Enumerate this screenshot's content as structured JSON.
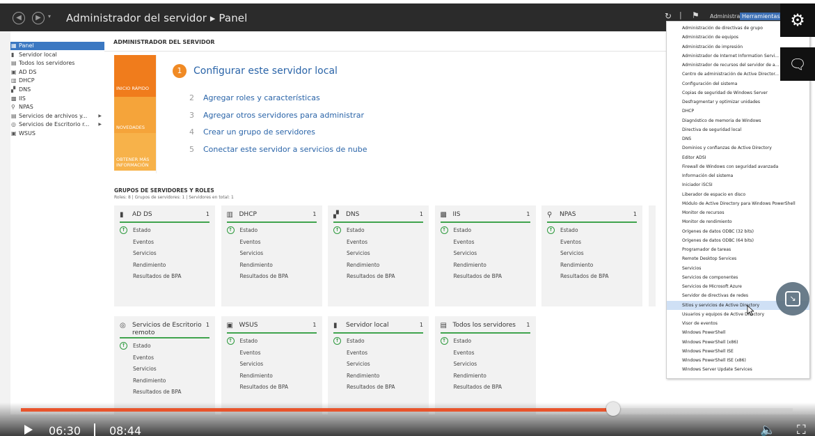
{
  "window": {
    "breadcrumb": "Administrador del servidor ▸ Panel",
    "refresh_glyph": "↻",
    "flag_glyph": "⚑",
    "menu_administrar": "Administrar",
    "menu_herramientas": "Herramientas"
  },
  "sidebar": {
    "items": [
      {
        "label": "Panel",
        "icon": "▦",
        "icon_name": "dashboard-icon"
      },
      {
        "label": "Servidor local",
        "icon": "▮",
        "icon_name": "server-icon"
      },
      {
        "label": "Todos los servidores",
        "icon": "▤",
        "icon_name": "servers-icon"
      },
      {
        "label": "AD DS",
        "icon": "▣",
        "icon_name": "adds-icon"
      },
      {
        "label": "DHCP",
        "icon": "▥",
        "icon_name": "dhcp-icon"
      },
      {
        "label": "DNS",
        "icon": "▞",
        "icon_name": "dns-icon"
      },
      {
        "label": "IIS",
        "icon": "▩",
        "icon_name": "iis-icon"
      },
      {
        "label": "NPAS",
        "icon": "⚲",
        "icon_name": "npas-icon"
      },
      {
        "label": "Servicios de archivos y...",
        "icon": "▤",
        "icon_name": "file-services-icon"
      },
      {
        "label": "Servicios de Escritorio r...",
        "icon": "◎",
        "icon_name": "remote-desktop-icon"
      },
      {
        "label": "WSUS",
        "icon": "▣",
        "icon_name": "wsus-icon"
      }
    ]
  },
  "main": {
    "header": "ADMINISTRADOR DEL SERVIDOR",
    "quickstart": {
      "inicio_rapido": "INICIO RÁPIDO",
      "novedades": "NOVEDADES",
      "obtener_mas": "OBTENER MÁS INFORMACIÓN",
      "main_step_number": "1",
      "main_step_label": "Configurar este servidor local",
      "steps": [
        {
          "num": "2",
          "label": "Agregar roles y características"
        },
        {
          "num": "3",
          "label": "Agregar otros servidores para administrar"
        },
        {
          "num": "4",
          "label": "Crear un grupo de servidores"
        },
        {
          "num": "5",
          "label": "Conectar este servidor a servicios de nube"
        }
      ]
    },
    "groups": {
      "title": "GRUPOS DE SERVIDORES Y ROLES",
      "subtitle": "Roles: 8   |   Grupos de servidores: 1   |   Servidores en total: 1",
      "cards_row1": [
        {
          "title": "AD DS",
          "count": "1",
          "icon": "▮",
          "icon_name": "adds-icon"
        },
        {
          "title": "DHCP",
          "count": "1",
          "icon": "▥",
          "icon_name": "dhcp-icon"
        },
        {
          "title": "DNS",
          "count": "1",
          "icon": "▞",
          "icon_name": "dns-icon"
        },
        {
          "title": "IIS",
          "count": "1",
          "icon": "▩",
          "icon_name": "iis-icon"
        },
        {
          "title": "NPAS",
          "count": "1",
          "icon": "⚲",
          "icon_name": "npas-icon"
        }
      ],
      "cards_row2": [
        {
          "title": "Servicios de Escritorio remoto",
          "count": "1",
          "icon": "◎",
          "icon_name": "remote-desktop-icon"
        },
        {
          "title": "WSUS",
          "count": "1",
          "icon": "▣",
          "icon_name": "wsus-icon"
        },
        {
          "title": "Servidor local",
          "count": "1",
          "icon": "▮",
          "icon_name": "server-icon"
        },
        {
          "title": "Todos los servidores",
          "count": "1",
          "icon": "▤",
          "icon_name": "servers-icon"
        }
      ],
      "card_rows": [
        "Estado",
        "Eventos",
        "Servicios",
        "Rendimiento",
        "Resultados de BPA"
      ]
    }
  },
  "tools_menu": {
    "items": [
      "Administración de directivas de grupo",
      "Administración de equipos",
      "Administración de impresión",
      "Administrador de Internet Information Servi...",
      "Administrador de recursos del servidor de a...",
      "Centro de administración de Active Director...",
      "Configuración del sistema",
      "Copias de seguridad de Windows Server",
      "Desfragmentar y optimizar unidades",
      "DHCP",
      "Diagnóstico de memoria de Windows",
      "Directiva de seguridad local",
      "DNS",
      "Dominios y confianzas de Active Directory",
      "Editor ADSI",
      "Firewall de Windows con seguridad avanzada",
      "Información del sistema",
      "Iniciador iSCSI",
      "Liberador de espacio en disco",
      "Módulo de Active Directory para Windows PowerShell",
      "Monitor de recursos",
      "Monitor de rendimiento",
      "Orígenes de datos ODBC (32 bits)",
      "Orígenes de datos ODBC (64 bits)",
      "Programador de tareas",
      "Remote Desktop Services",
      "Servicios",
      "Servicios de componentes",
      "Servicios de Microsoft Azure",
      "Servidor de directivas de redes",
      "Sitios y servicios de Active Directory",
      "Usuarios y equipos de Active Directory",
      "Visor de eventos",
      "Windows PowerShell",
      "Windows PowerShell (x86)",
      "Windows PowerShell ISE",
      "Windows PowerShell ISE (x86)",
      "Windows Server Update Services"
    ],
    "highlighted_item": "Sitios y servicios de Active Directory"
  },
  "player": {
    "current_time": "06:30",
    "total_time": "08:44",
    "progress": 0.767,
    "settings_glyph": "⚙",
    "comment_glyph": "🗨",
    "pip_glyph": "↘",
    "volume_glyph": "🔈",
    "fullscreen_glyph": "⛶"
  },
  "colors": {
    "accent_orange": "#f08a24",
    "link_blue": "#2a64a8",
    "status_green": "#2e9a3e",
    "progress_red": "#e8542c",
    "selection_blue": "#3b78c2"
  }
}
